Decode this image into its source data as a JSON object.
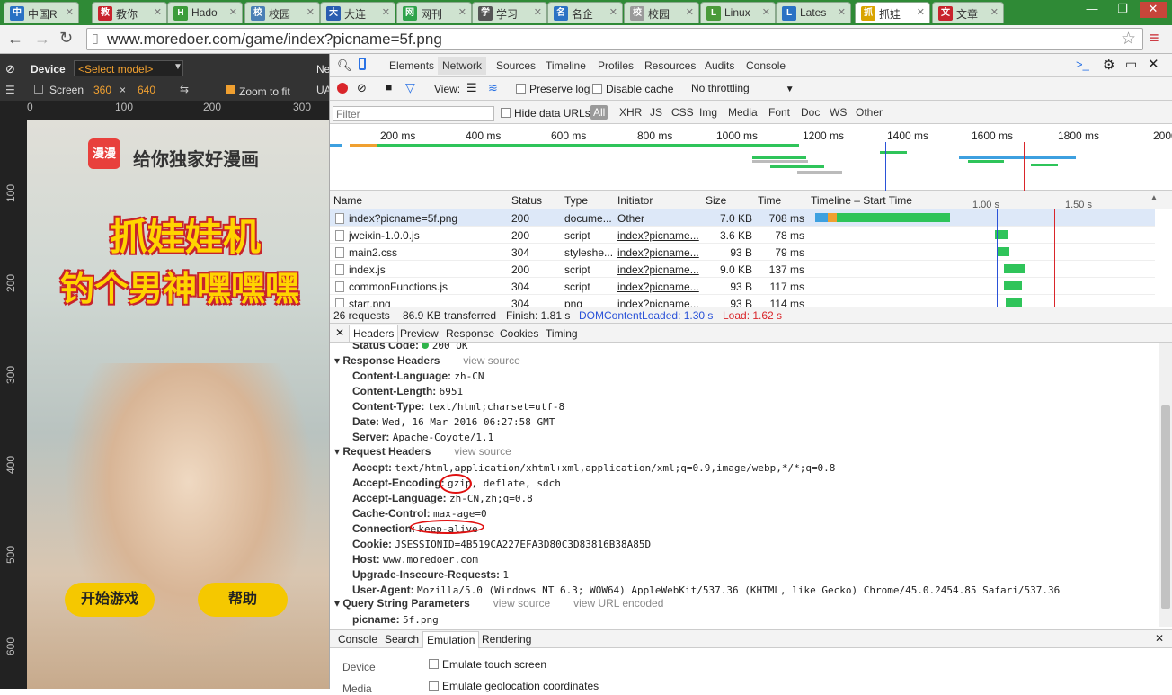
{
  "browser": {
    "tabs": [
      {
        "label": "中国R",
        "icon": "grid-icon",
        "color": "#2a72c4"
      },
      {
        "label": "教你",
        "icon": "c-logo-icon",
        "color": "#c8232c"
      },
      {
        "label": "Hado",
        "icon": "hadoop-icon",
        "color": "#3c9c3a"
      },
      {
        "label": "校园",
        "icon": "globe-icon",
        "color": "#4a7fb5"
      },
      {
        "label": "大连",
        "icon": "paw-icon",
        "color": "#2a5db0"
      },
      {
        "label": "网刊",
        "icon": "in-icon",
        "color": "#2fa34a"
      },
      {
        "label": "学习",
        "icon": "gear-icon",
        "color": "#555555"
      },
      {
        "label": "名企",
        "icon": "app-icon",
        "color": "#2a72c4"
      },
      {
        "label": "校园",
        "icon": "page-icon",
        "color": "#9a9a9a"
      },
      {
        "label": "Linux",
        "icon": "linux-icon",
        "color": "#4a9a3a"
      },
      {
        "label": "Lates",
        "icon": "gt-icon",
        "color": "#2a72c4"
      },
      {
        "label": "抓娃",
        "icon": "comic-icon",
        "color": "#d9a400"
      },
      {
        "label": "文章",
        "icon": "c-logo-icon",
        "color": "#c8232c"
      }
    ],
    "url": "www.moredoer.com/game/index?picname=5f.png"
  },
  "device": {
    "label": "Device",
    "model": "<Select model>",
    "screen_label": "Screen",
    "width": "360",
    "times": "×",
    "height": "640",
    "zoom_label": "Zoom to fit",
    "extra1": "Ne",
    "extra2": "UA",
    "ruler_top": [
      "0",
      "100",
      "200",
      "300"
    ],
    "ruler_left": [
      "100",
      "200",
      "300",
      "400",
      "500",
      "600"
    ]
  },
  "game": {
    "brand": "漫漫",
    "slogan": "给你独家好漫画",
    "title1": "抓娃娃机",
    "title2": "钓个男神嘿嘿嘿",
    "start": "开始游戏",
    "help": "帮助"
  },
  "devtools": {
    "tabs": [
      "Elements",
      "Network",
      "Sources",
      "Timeline",
      "Profiles",
      "Resources",
      "Audits",
      "Console"
    ],
    "view_label": "View:",
    "preserve_log": "Preserve log",
    "disable_cache": "Disable cache",
    "throttling": "No throttling",
    "filter_placeholder": "Filter",
    "hide_data_urls": "Hide data URLs",
    "types": [
      "All",
      "XHR",
      "JS",
      "CSS",
      "Img",
      "Media",
      "Font",
      "Doc",
      "WS",
      "Other"
    ],
    "overview_ticks": [
      "200 ms",
      "400 ms",
      "600 ms",
      "800 ms",
      "1000 ms",
      "1200 ms",
      "1400 ms",
      "1600 ms",
      "1800 ms",
      "2000"
    ],
    "columns": [
      "Name",
      "Status",
      "Type",
      "Initiator",
      "Size",
      "Time",
      "Timeline – Start Time"
    ],
    "timeline_ticks": [
      "1.00 s",
      "1.50 s"
    ],
    "requests": [
      {
        "name": "index?picname=5f.png",
        "status": "200",
        "type": "docume...",
        "initiator": "Other",
        "size": "7.0 KB",
        "time": "708 ms"
      },
      {
        "name": "jweixin-1.0.0.js",
        "status": "200",
        "type": "script",
        "initiator": "index?picname...",
        "size": "3.6 KB",
        "time": "78 ms"
      },
      {
        "name": "main2.css",
        "status": "304",
        "type": "styleshe...",
        "initiator": "index?picname...",
        "size": "93 B",
        "time": "79 ms"
      },
      {
        "name": "index.js",
        "status": "200",
        "type": "script",
        "initiator": "index?picname...",
        "size": "9.0 KB",
        "time": "137 ms"
      },
      {
        "name": "commonFunctions.js",
        "status": "304",
        "type": "script",
        "initiator": "index?picname...",
        "size": "93 B",
        "time": "117 ms"
      },
      {
        "name": "start.png",
        "status": "304",
        "type": "png",
        "initiator": "index?picname...",
        "size": "93 B",
        "time": "114 ms"
      }
    ],
    "summary": {
      "requests": "26 requests",
      "transferred": "86.9 KB transferred",
      "finish": "Finish: 1.81 s",
      "dom": "DOMContentLoaded: 1.30 s",
      "load": "Load: 1.62 s"
    },
    "detail_tabs": [
      "Headers",
      "Preview",
      "Response",
      "Cookies",
      "Timing"
    ],
    "status_code_label": "Status Code:",
    "status_code": "200 OK",
    "response_headers_title": "Response Headers",
    "request_headers_title": "Request Headers",
    "query_title": "Query String Parameters",
    "view_source": "view source",
    "view_url_encoded": "view URL encoded",
    "response_headers": [
      {
        "k": "Content-Language:",
        "v": "zh-CN"
      },
      {
        "k": "Content-Length:",
        "v": "6951"
      },
      {
        "k": "Content-Type:",
        "v": "text/html;charset=utf-8"
      },
      {
        "k": "Date:",
        "v": "Wed, 16 Mar 2016 06:27:58 GMT"
      },
      {
        "k": "Server:",
        "v": "Apache-Coyote/1.1"
      }
    ],
    "request_headers": [
      {
        "k": "Accept:",
        "v": "text/html,application/xhtml+xml,application/xml;q=0.9,image/webp,*/*;q=0.8"
      },
      {
        "k": "Accept-Encoding:",
        "v": "gzip, deflate, sdch"
      },
      {
        "k": "Accept-Language:",
        "v": "zh-CN,zh;q=0.8"
      },
      {
        "k": "Cache-Control:",
        "v": "max-age=0"
      },
      {
        "k": "Connection:",
        "v": "keep-alive"
      },
      {
        "k": "Cookie:",
        "v": "JSESSIONID=4B519CA227EFA3D80C3D83816B38A85D"
      },
      {
        "k": "Host:",
        "v": "www.moredoer.com"
      },
      {
        "k": "Upgrade-Insecure-Requests:",
        "v": "1"
      },
      {
        "k": "User-Agent:",
        "v": "Mozilla/5.0 (Windows NT 6.3; WOW64) AppleWebKit/537.36 (KHTML, like Gecko) Chrome/45.0.2454.85 Safari/537.36"
      }
    ],
    "query_params": [
      {
        "k": "picname:",
        "v": "5f.png"
      }
    ],
    "drawer_tabs": [
      "Console",
      "Search",
      "Emulation",
      "Rendering"
    ],
    "emulation": {
      "device_label": "Device",
      "media_label": "Media",
      "touch": "Emulate touch screen",
      "geo": "Emulate geolocation coordinates"
    }
  }
}
